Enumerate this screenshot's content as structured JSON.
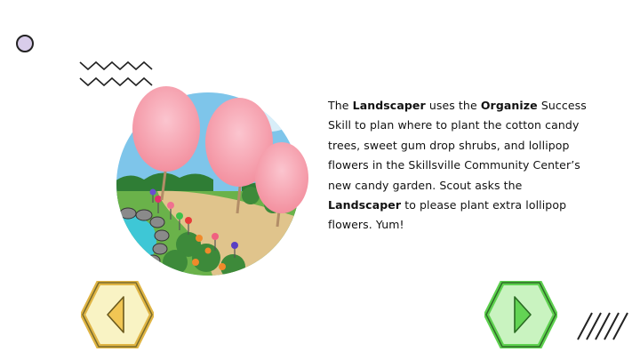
{
  "story": {
    "segments": [
      {
        "text": "The ",
        "bold": false
      },
      {
        "text": "Landscaper",
        "bold": true
      },
      {
        "text": " uses the ",
        "bold": false
      },
      {
        "text": "Organize",
        "bold": true
      },
      {
        "text": " Success Skill to plan where to plant the cotton candy trees, sweet gum drop shrubs, and lollipop flowers in the Skillsville Community Center’s new candy garden. Scout asks the ",
        "bold": false
      },
      {
        "text": "Landscaper",
        "bold": true
      },
      {
        "text": " to please plant extra lollipop flowers. Yum!",
        "bold": false
      }
    ]
  },
  "navigation": {
    "back": {
      "icon": "triangle-left-icon",
      "fill": "#f9f3c4",
      "border": "#e0b545"
    },
    "next": {
      "icon": "triangle-right-icon",
      "fill": "#c9f3c0",
      "border": "#5ed14f"
    }
  },
  "colors": {
    "accent_dot": "#d9cdea",
    "sky": "#7ec5ea",
    "path": "#e0c48c",
    "water": "#3ec7d6",
    "cotton_candy": "#f7a9b6"
  }
}
